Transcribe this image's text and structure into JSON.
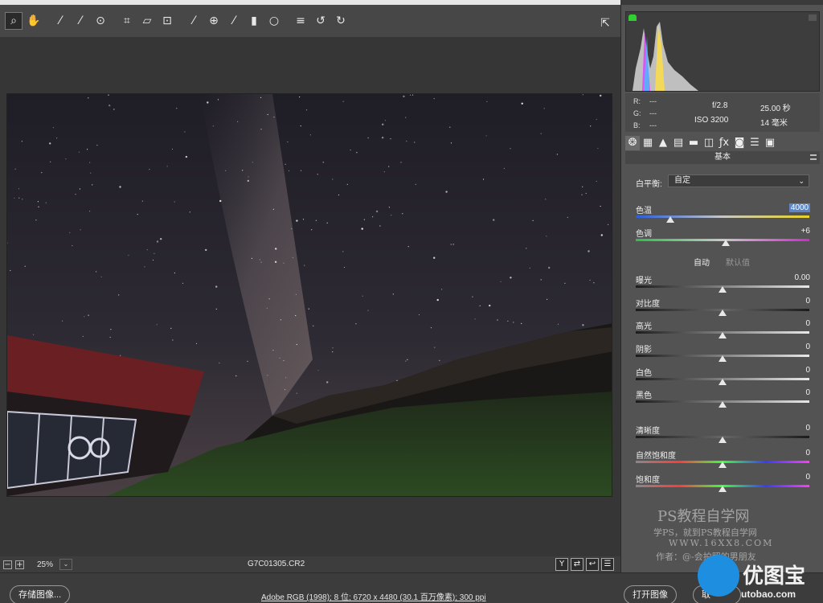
{
  "toolbar": {
    "tools": [
      "zoom-icon",
      "hand-icon",
      "white-balance-icon",
      "color-sampler-icon",
      "target-adjust-icon",
      "crop-icon",
      "straighten-icon",
      "transform-icon",
      "spot-removal-icon",
      "red-eye-icon",
      "adjustment-brush-icon",
      "graduated-filter-icon",
      "radial-filter-icon",
      "preferences-icon",
      "rotate-ccw-icon",
      "rotate-cw-icon"
    ],
    "glyphs": [
      "⌕",
      "✋",
      "⁄",
      "⁄",
      "⊙",
      "⌗",
      "▱",
      "⊡",
      "⁄",
      "⊕",
      "⁄",
      "▮",
      "○",
      "≡",
      "↺",
      "↻"
    ],
    "fullscreen_glyph": "⇱"
  },
  "canvas": {
    "zoom_minus": "−",
    "zoom_plus": "+",
    "zoom_level": "25%",
    "zoom_dropdown": "⌄",
    "filename": "G7C01305.CR2",
    "view_icons": [
      "Y",
      "⇄",
      "↩",
      "☰"
    ]
  },
  "footer": {
    "save_label": "存储图像...",
    "workflow": "Adobe RGB (1998); 8 位;  6720 x 4480 (30.1 百万像素); 300 ppi",
    "open_label": "打开图像",
    "cancel_label": "取"
  },
  "histogram": {
    "r_label": "R:",
    "r_val": "---",
    "g_label": "G:",
    "g_val": "---",
    "b_label": "B:",
    "b_val": "---",
    "aperture": "f/2.8",
    "shutter": "25.00 秒",
    "iso": "ISO 3200",
    "focal": "14 毫米"
  },
  "panel": {
    "tab_glyphs": [
      "❂",
      "▦",
      "▲",
      "▤",
      "▬",
      "◫",
      "ƒx",
      "◙",
      "☰",
      "▣"
    ],
    "section_title": "基本",
    "wb_label": "白平衡:",
    "wb_value": "自定",
    "auto": "自动",
    "default": "默认值",
    "sliders": [
      {
        "label": "色温",
        "value": "4000",
        "pos": 0.2
      },
      {
        "label": "色调",
        "value": "+6",
        "pos": 0.52
      },
      {
        "label": "曝光",
        "value": "0.00",
        "pos": 0.5
      },
      {
        "label": "对比度",
        "value": "0",
        "pos": 0.5
      },
      {
        "label": "高光",
        "value": "0",
        "pos": 0.5
      },
      {
        "label": "阴影",
        "value": "0",
        "pos": 0.5
      },
      {
        "label": "白色",
        "value": "0",
        "pos": 0.5
      },
      {
        "label": "黑色",
        "value": "0",
        "pos": 0.5
      },
      {
        "label": "清晰度",
        "value": "0",
        "pos": 0.5
      },
      {
        "label": "自然饱和度",
        "value": "0",
        "pos": 0.5
      },
      {
        "label": "饱和度",
        "value": "0",
        "pos": 0.5
      }
    ]
  },
  "watermark": {
    "title": "PS教程自学网",
    "line1": "学PS，就到PS教程自学网",
    "line2": "WWW.16XX8.COM",
    "line3": "作者：@-会拍照的男朋友",
    "logo_text": "优图宝",
    "logo_url": "utobao.com"
  }
}
